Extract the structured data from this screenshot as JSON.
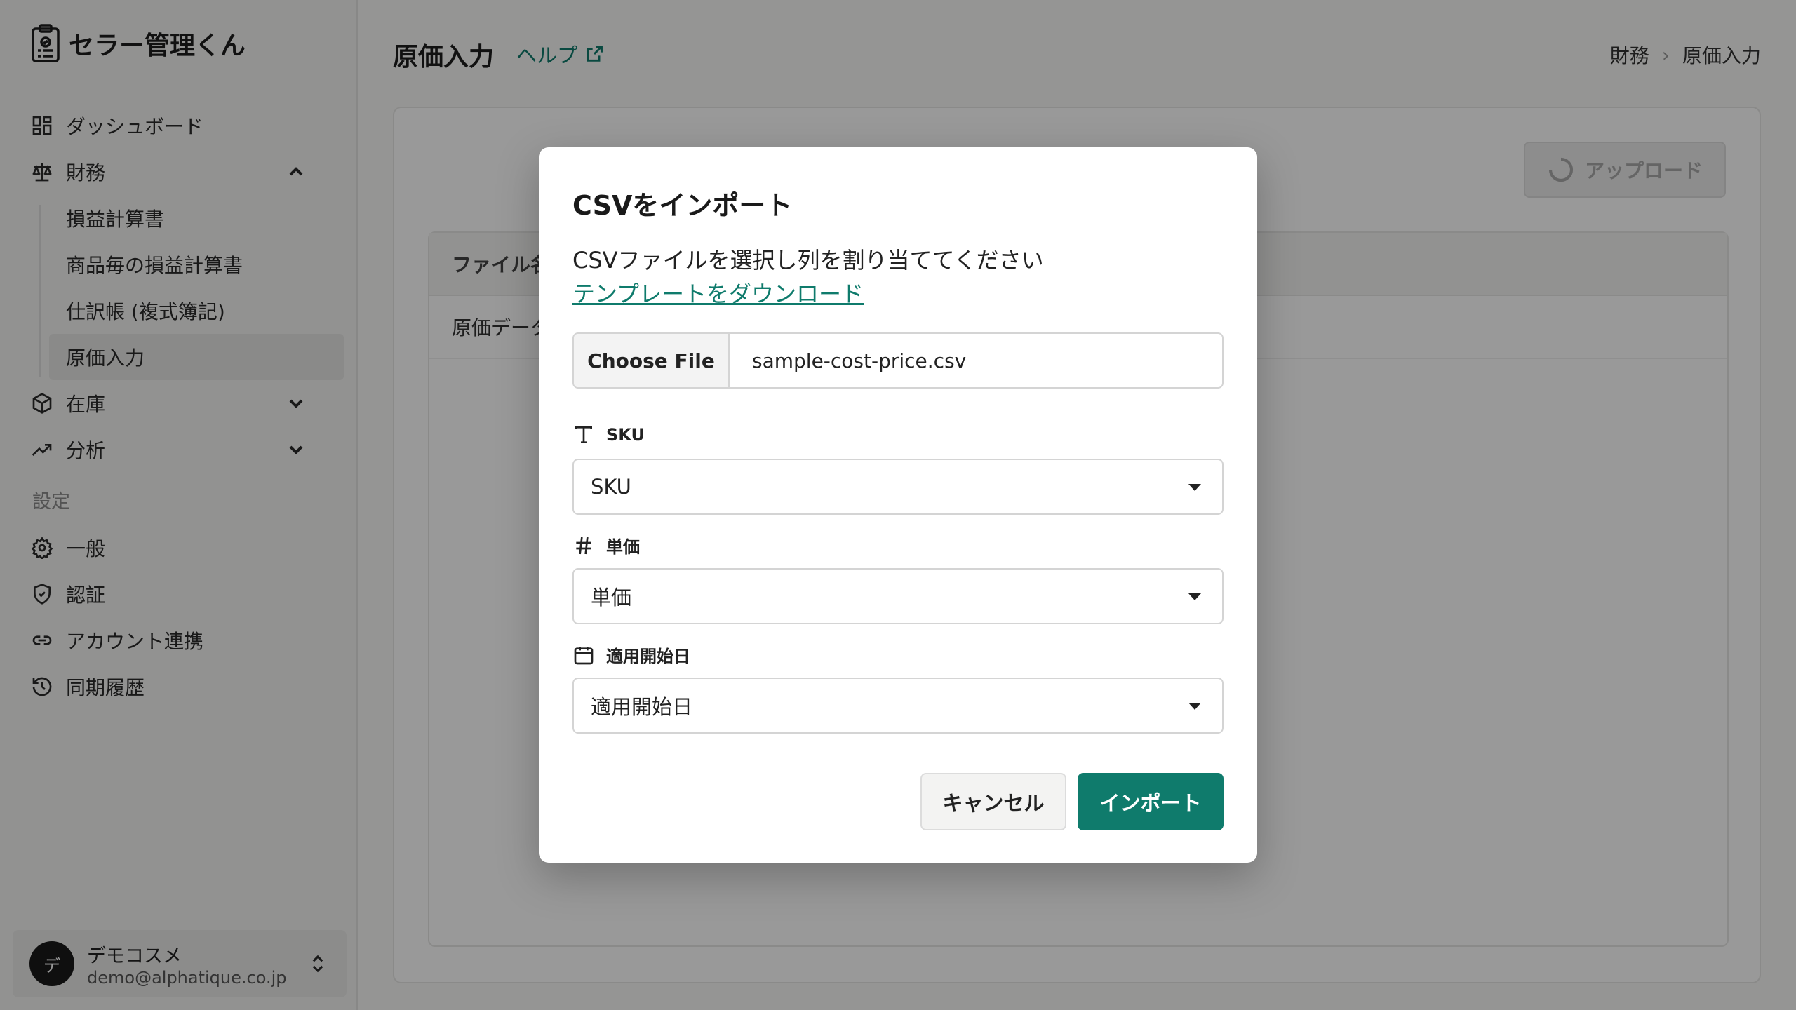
{
  "app": {
    "brand": "セラー管理くん"
  },
  "sidebar": {
    "nav": [
      {
        "label": "ダッシュボード",
        "icon": "dashboard-icon"
      },
      {
        "label": "財務",
        "icon": "scale-icon"
      },
      {
        "label": "在庫",
        "icon": "box-icon"
      },
      {
        "label": "分析",
        "icon": "trending-up-icon"
      }
    ],
    "finance_sub": [
      "損益計算書",
      "商品毎の損益計算書",
      "仕訳帳 (複式簿記)",
      "原価入力"
    ],
    "settings_label": "設定",
    "settings": [
      {
        "label": "一般",
        "icon": "gear-icon"
      },
      {
        "label": "認証",
        "icon": "shield-icon"
      },
      {
        "label": "アカウント連携",
        "icon": "link-icon"
      },
      {
        "label": "同期履歴",
        "icon": "history-icon"
      }
    ],
    "account": {
      "avatar": "デ",
      "name": "デモコスメ",
      "email": "demo@alphatique.co.jp"
    }
  },
  "header": {
    "title": "原価入力",
    "help": "ヘルプ",
    "breadcrumb": [
      "財務",
      "原価入力"
    ]
  },
  "main": {
    "upload_label": "アップロード",
    "table_header": "ファイル名",
    "row": "原価データ"
  },
  "modal": {
    "title": "CSVをインポート",
    "description": "CSVファイルを選択し列を割り当ててください",
    "template_link": "テンプレートをダウンロード",
    "file_button": "Choose File",
    "file_name": "sample-cost-price.csv",
    "fields": [
      {
        "label": "SKU",
        "icon": "text-icon",
        "value": "SKU"
      },
      {
        "label": "単価",
        "icon": "hash-icon",
        "value": "単価"
      },
      {
        "label": "適用開始日",
        "icon": "calendar-icon",
        "value": "適用開始日"
      }
    ],
    "cancel": "キャンセル",
    "import": "インポート"
  },
  "colors": {
    "accent": "#0f7b6c"
  }
}
